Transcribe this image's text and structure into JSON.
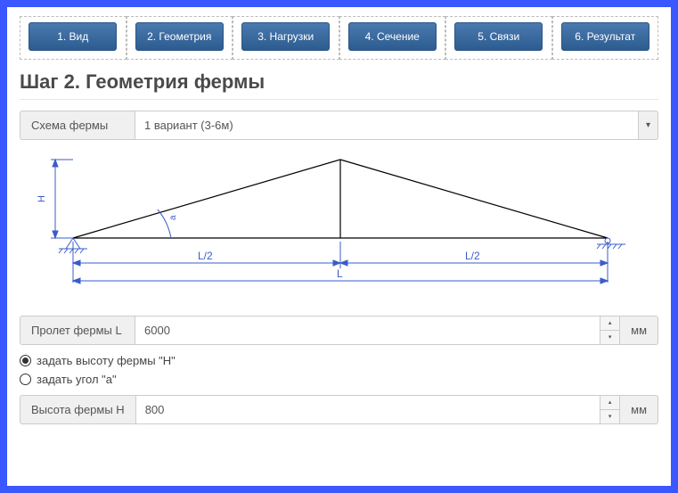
{
  "tabs": [
    "1. Вид",
    "2. Геометрия",
    "3. Нагрузки",
    "4. Сечение",
    "5. Связи",
    "6. Результат"
  ],
  "step_title": "Шаг 2. Геометрия фермы",
  "scheme": {
    "label": "Схема фермы",
    "selected": "1 вариант (3-6м)"
  },
  "diagram": {
    "H": "H",
    "a": "a",
    "L2_left": "L/2",
    "L2_right": "L/2",
    "L": "L"
  },
  "span": {
    "label": "Пролет фермы L",
    "value": "6000",
    "unit": "мм"
  },
  "radios": {
    "by_height": "задать высоту фермы \"H\"",
    "by_angle": "задать угол \"a\""
  },
  "height": {
    "label": "Высота фермы H",
    "value": "800",
    "unit": "мм"
  },
  "chart_data": {
    "type": "diagram",
    "description": "Triangular roof truss schematic",
    "span_L_mm": 6000,
    "height_H_mm": 800,
    "half_span_label": "L/2",
    "angle_label": "a",
    "supports": [
      "pin-left",
      "roller-right"
    ]
  }
}
